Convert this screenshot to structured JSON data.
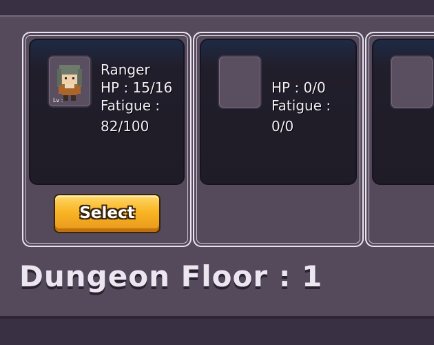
{
  "cards": [
    {
      "portrait_icon": "ranger-character-sprite",
      "level_label": "Lv :",
      "name": "Ranger",
      "hp": "HP : 15/16",
      "fatigue_label": "Fatigue :",
      "fatigue_value": "82/100",
      "button_label": "Select"
    },
    {
      "portrait_icon": "empty-slot",
      "hp": "HP : 0/0",
      "fatigue_label": "Fatigue :",
      "fatigue_value": "0/0"
    },
    {
      "portrait_icon": "empty-slot"
    }
  ],
  "floor": {
    "label": "Dungeon Floor : 1"
  },
  "colors": {
    "button": "#f9b524",
    "card_bg": "#211e2b",
    "panel": "#55495c",
    "text": "#f3eff6"
  }
}
